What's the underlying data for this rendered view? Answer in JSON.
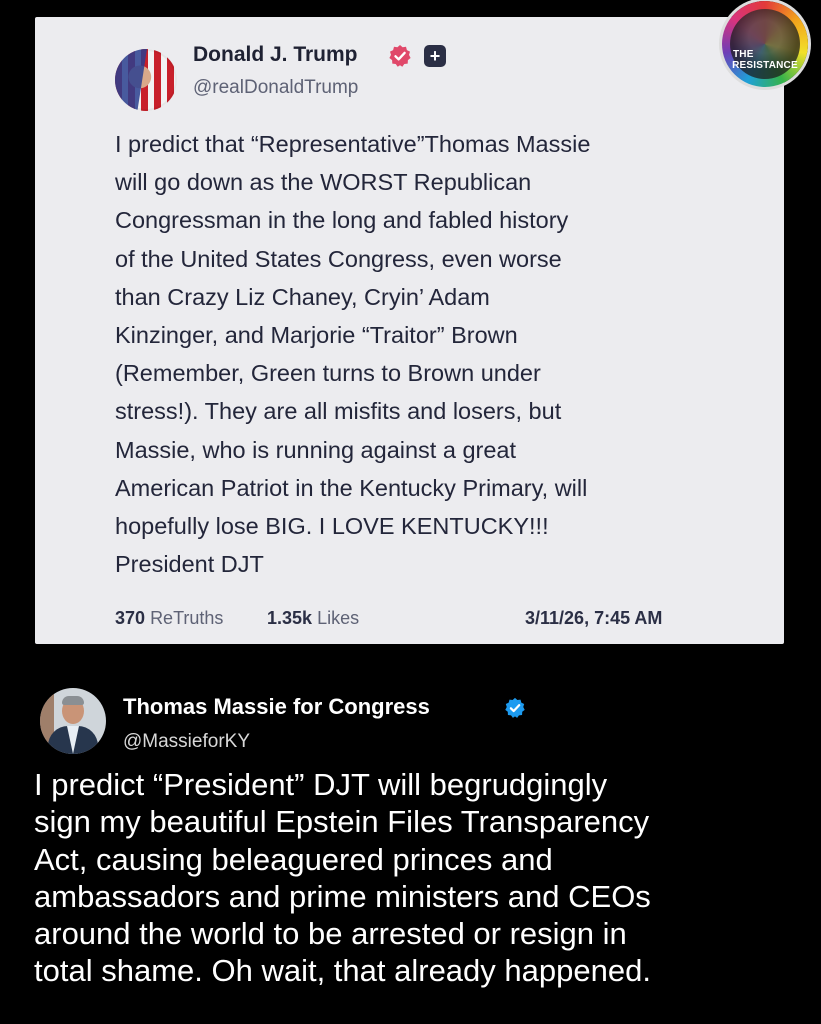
{
  "truth_post": {
    "author_name": "Donald J. Trump",
    "author_handle": "@realDonaldTrump",
    "verified_badge_color": "#e0486a",
    "icons": [
      "verified-badge-icon",
      "plus-icon"
    ],
    "body_lines": [
      "I predict that “Representative”Thomas Massie",
      "will go down as the WORST Republican",
      "Congressman in the long and fabled history",
      "of the United States Congress, even worse",
      "than Crazy Liz Chaney, Cryin’ Adam",
      "Kinzinger, and Marjorie “Traitor” Brown",
      "(Remember, Green turns to Brown under",
      "stress!). They are all misfits and losers, but",
      "Massie, who is running against a great",
      "American Patriot in the Kentucky Primary, will",
      "hopefully lose BIG. I LOVE KENTUCKY!!!",
      "President DJT"
    ],
    "retruths_count": "370",
    "retruths_label": "ReTruths",
    "likes_count": "1.35k",
    "likes_label": "Likes",
    "timestamp": "3/11/26, 7:45 AM"
  },
  "watermark": {
    "line1": "THE",
    "line2": "RESISTANCE"
  },
  "reply_post": {
    "author_name": "Thomas Massie for Congress",
    "author_handle": "@MassieforKY",
    "verified_badge_color": "#1d9bf0",
    "body_lines": [
      "I predict “President” DJT will begrudgingly",
      "sign my beautiful Epstein Files Transparency",
      "Act, causing beleaguered princes and",
      "ambassadors and prime ministers and CEOs",
      "around the world to be arrested or resign in",
      "total shame. Oh wait, that already happened."
    ]
  }
}
